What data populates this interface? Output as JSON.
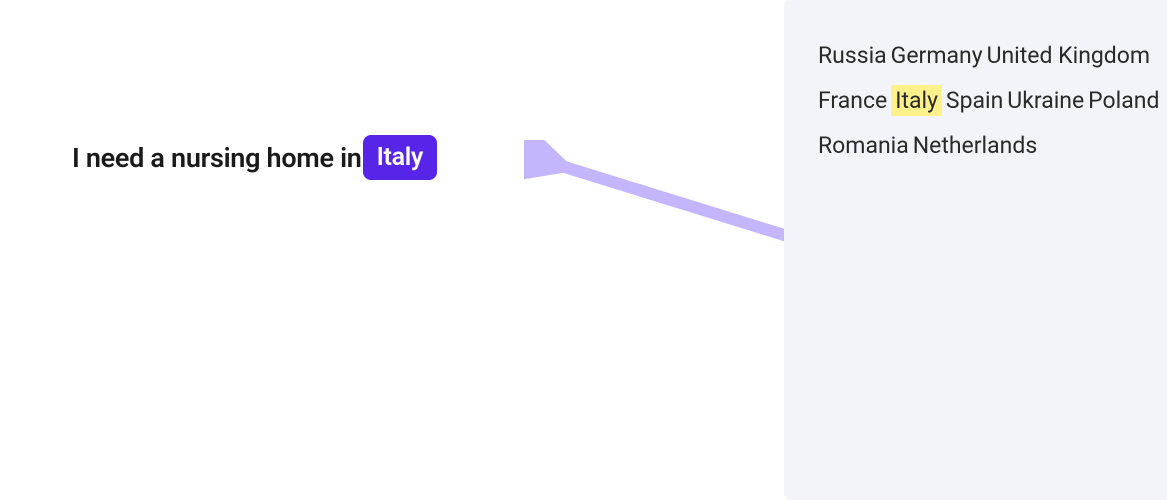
{
  "sentence": {
    "prefix": "I need a nursing home in",
    "selected": "Italy"
  },
  "countries": [
    {
      "label": "Russia",
      "highlighted": false
    },
    {
      "label": "Germany",
      "highlighted": false
    },
    {
      "label": "United Kingdom",
      "highlighted": false
    },
    {
      "label": "France",
      "highlighted": false
    },
    {
      "label": "Italy",
      "highlighted": true
    },
    {
      "label": "Spain",
      "highlighted": false
    },
    {
      "label": "Ukraine",
      "highlighted": false
    },
    {
      "label": "Poland",
      "highlighted": false
    },
    {
      "label": "Romania",
      "highlighted": false
    },
    {
      "label": "Netherlands",
      "highlighted": false
    }
  ],
  "colors": {
    "pill_bg": "#5725e8",
    "panel_bg": "#f3f4fa",
    "highlight_bg": "#fef08a",
    "arrow": "#c4b5fd"
  }
}
